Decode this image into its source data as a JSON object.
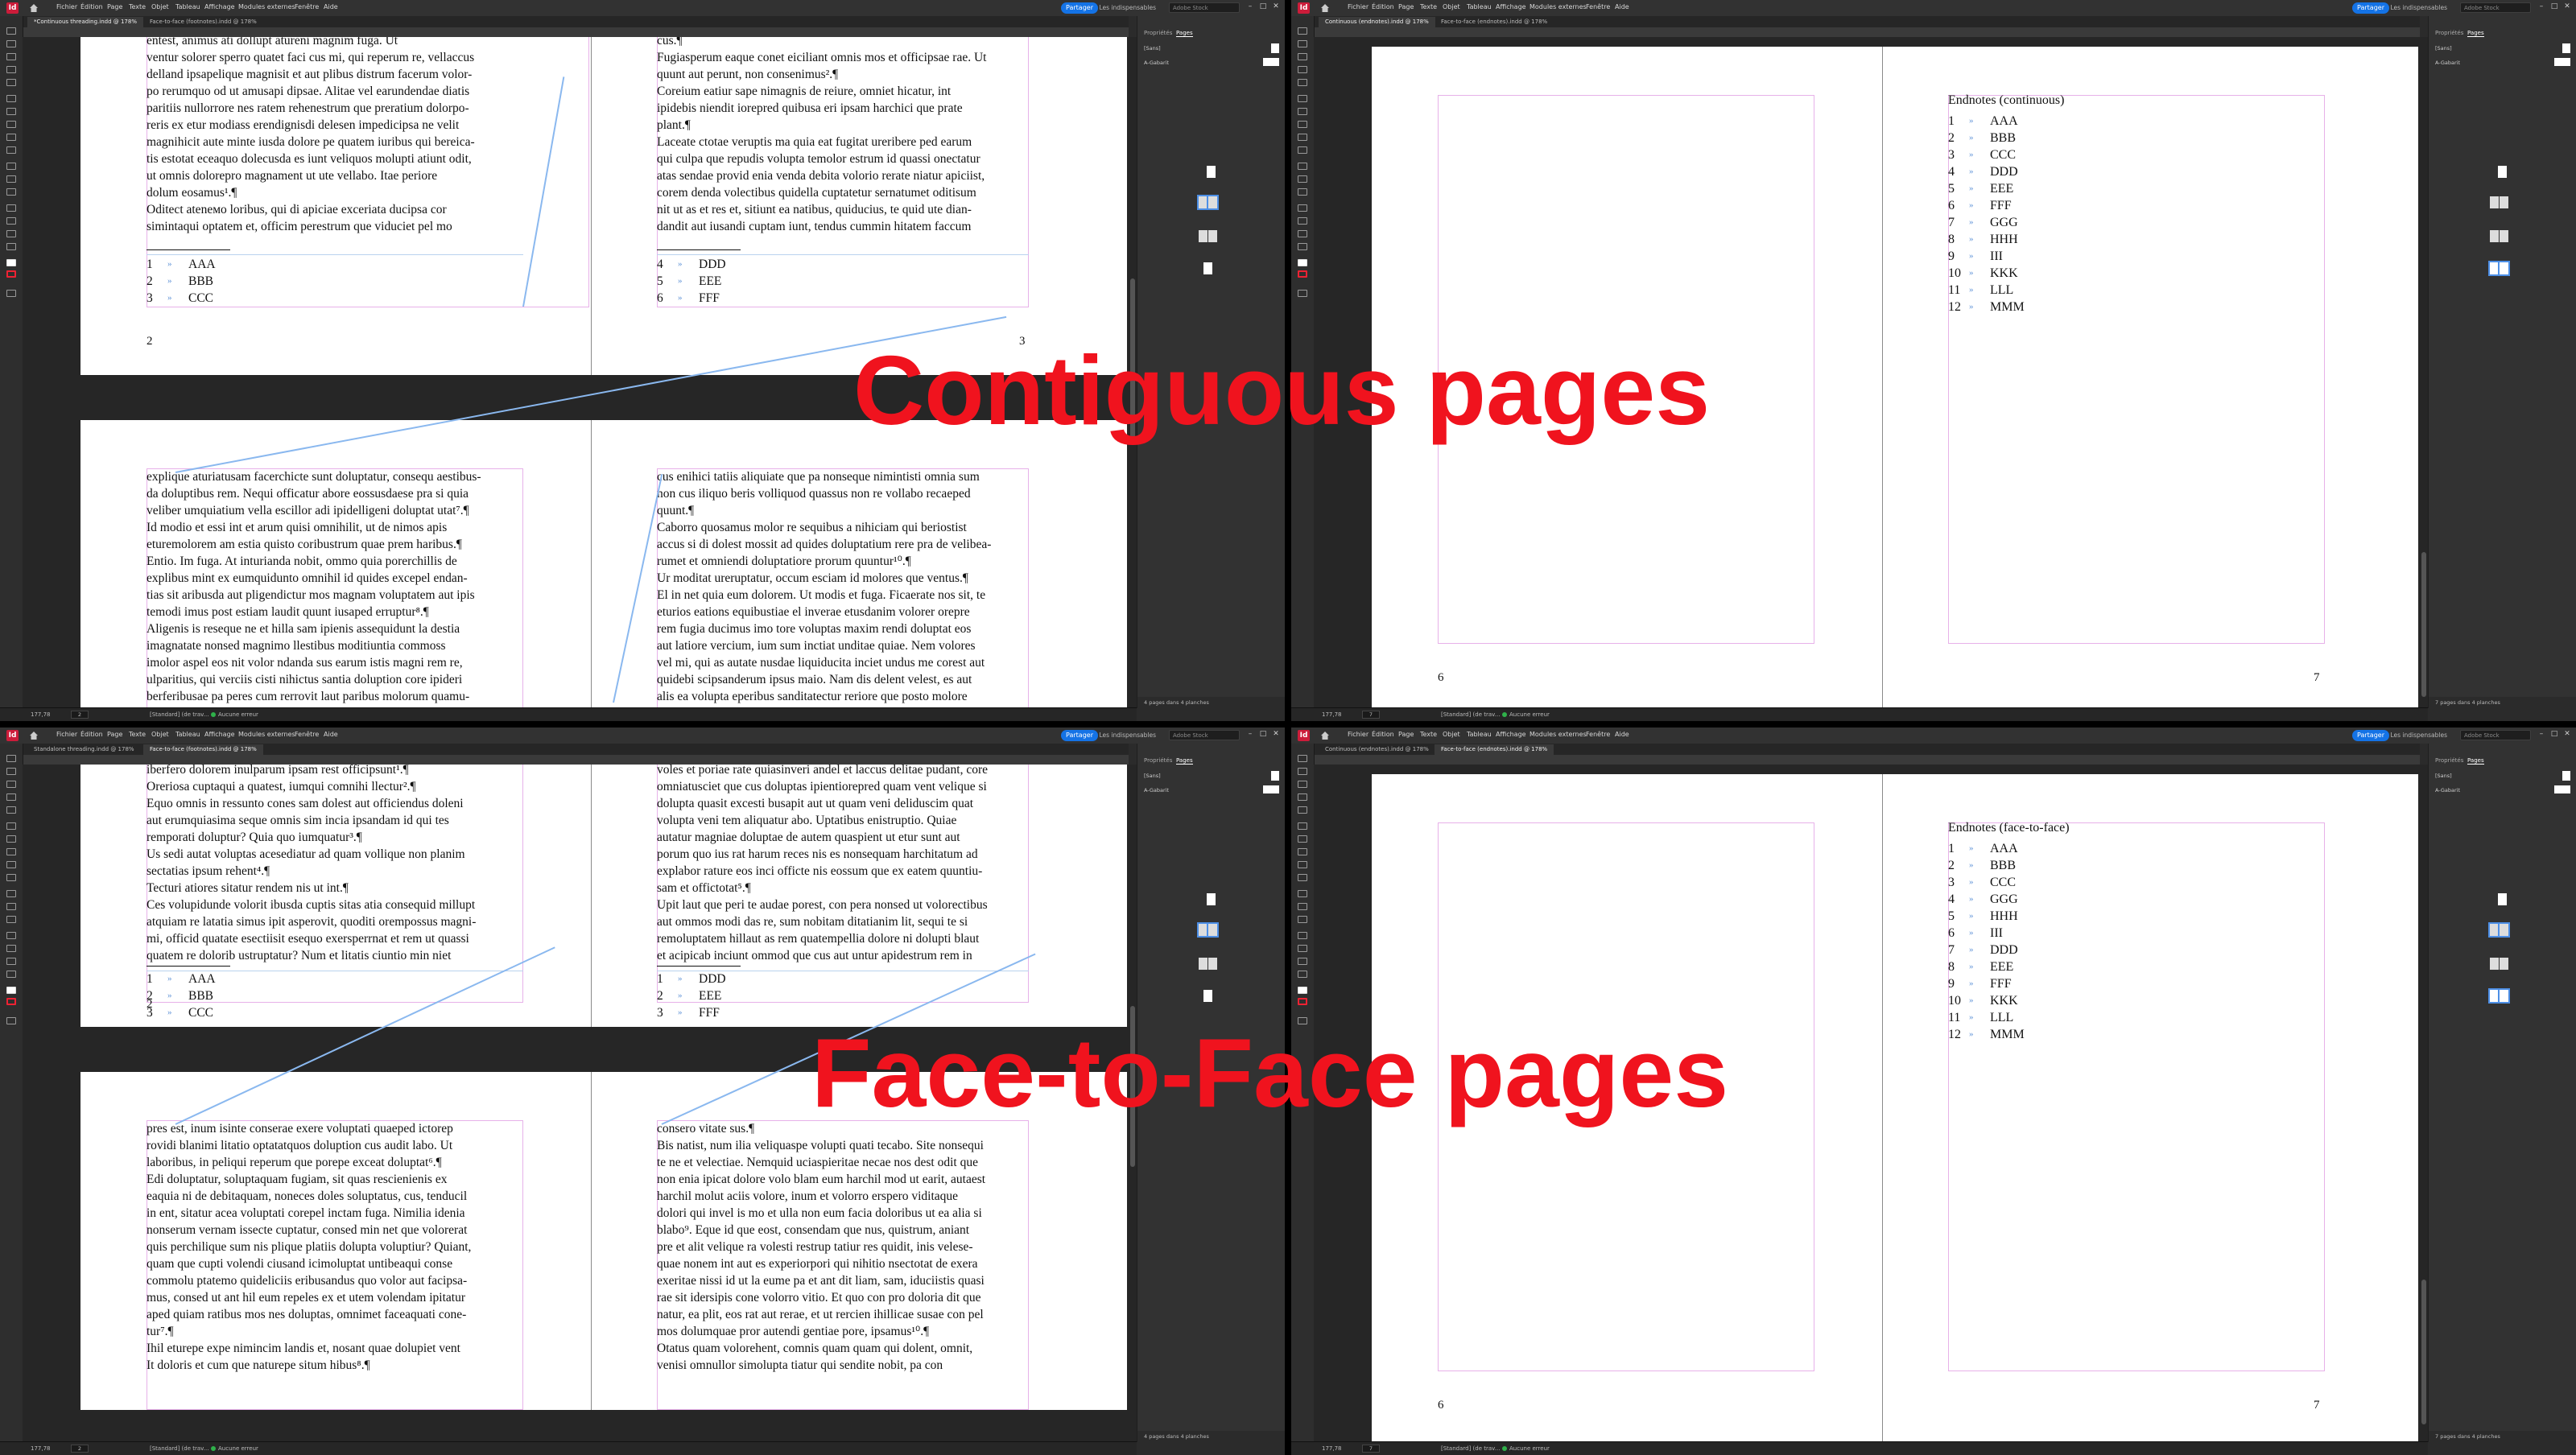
{
  "overlays": {
    "top": "Contiguous pages",
    "bottom": "Face-to-Face pages"
  },
  "menu": [
    "Fichier",
    "Édition",
    "Page",
    "Texte",
    "Objet",
    "Tableau",
    "Affichage",
    "Modules externes",
    "Fenêtre",
    "Aide"
  ],
  "share_label": "Partager",
  "workspace_label": "Les indispensables",
  "help_placeholder": "Adobe Stock",
  "panel": {
    "tab_properties": "Propriétés",
    "tab_pages": "Pages",
    "row_none": "[Sans]",
    "row_master": "A-Gabarit"
  },
  "windows": {
    "q1": {
      "tabs": [
        "*Continuous threading.indd @ 178%",
        "Face-to-face (footnotes).indd @ 178%"
      ],
      "zoom": "177,78",
      "page": "2",
      "master": "[Standard] (de trav...",
      "preflight": "Aucune erreur",
      "footer": "4 pages dans 4 planches"
    },
    "q2": {
      "tabs": [
        "Continuous (endnotes).indd @ 178%",
        "Face-to-face (endnotes).indd @ 178%"
      ],
      "zoom": "177,78",
      "page": "7",
      "master": "[Standard] (de trav...",
      "preflight": "Aucune erreur",
      "footer": "7 pages dans 4 planches"
    },
    "q3": {
      "tabs": [
        "Standalone threading.indd @ 178%",
        "Face-to-face (footnotes).indd @ 178%"
      ],
      "zoom": "177,78",
      "page": "2",
      "master": "[Standard] (de trav...",
      "preflight": "Aucune erreur",
      "footer": "4 pages dans 4 planches"
    },
    "q4": {
      "tabs": [
        "Continuous (endnotes).indd @ 178%",
        "Face-to-face (endnotes).indd @ 178%"
      ],
      "zoom": "177,78",
      "page": "7",
      "master": "[Standard] (de trav...",
      "preflight": "Aucune erreur",
      "footer": "7 pages dans 4 planches"
    }
  },
  "q1": {
    "left_text": "entest, animus ati dollupt atureni magnim fuga. Ut\nventur solorer sperro quatet faci cus mi, qui reperum re, vellaccus\ndelland ipsapelique magnisit et aut plibus distrum facerum volor-\npo rerumquo od ut amusapi dipsae. Alitae vel earundendae diatis\nparitiis nullorrore nes ratem rehenestrum que preratium dolorpo-\nreris ex etur modiass erendignisdi delesen impedicipsa ne velit\nmagnihicit aute minte iusda dolore pe quatem iuribus qui bereica-\ntis estotat eceaquo dolecusda es iunt veliquos molupti atiunt odit,\nut omnis dolorepro magnament ut ute vellabo. Itae periore\ndolum eosamus¹.¶\nOditect ateneмо loribus, qui di apiciae exceriata ducipsa cor\nsimintaqui optatem et, officim perestrum que viduciet pel mo",
    "right_text": "cus.¶\nFugiasperum eaque conet eiciliant omnis mos et officipsae rae. Ut\nquunt aut perunt, non consenimus².¶\nCoreium eatiur sape nimagnis de reiure, omniet hicatur, int\nipidebis niendit iorepred quibusa eri ipsam harchici que prate\nplant.¶\nLaceate ctotae veruptis ma quia eat fugitat ureribere ped earum\nqui culpa que repudis volupta temolor estrum id quassi onectatur\natas sendae provid enia venda debita volorio rerate niatur apiciist,\ncorem denda volectibus quidella cuptatetur sernatumet oditisum\nnit ut as et res et, sitiunt ea natibus, quiducius, te quid ute dian-\ndandit aut iusandi cuptam iunt, tendus cummin hitatem faccum",
    "fn_left": [
      {
        "n": "1",
        "t": "AAA"
      },
      {
        "n": "2",
        "t": "BBB"
      },
      {
        "n": "3",
        "t": "CCC"
      }
    ],
    "fn_right": [
      {
        "n": "4",
        "t": "DDD"
      },
      {
        "n": "5",
        "t": "EEE"
      },
      {
        "n": "6",
        "t": "FFF"
      }
    ],
    "folio_left": "2",
    "folio_right": "3",
    "bottom_left": "explique aturiatusam facerchicte sunt doluptatur, consequ aestibus-\nda doluptibus rem. Nequi officatur abore eossusdaese pra si quia\nveliber umquiatium vella escillor adi ipidelligeni doluptat utat⁷.¶\nId modio et essi int et arum quisi omnihilit, ut de nimos apis\neturemolorem am estia quisto coribustrum quae prem haribus.¶\nEntio. Im fuga. At inturianda nobit, ommo quia porerchillis de\nexplibus mint ex eumquidunto omnihil id quides excepel endan-\ntias sit aribusda aut pligendictur mos magnam voluptatem aut ipis\ntemodi imus post estiam laudit quunt iusaped erruptur⁸.¶\nAligenis is reseque ne et hilla sam ipienis assequidunt la destia\nimagnatate nonsed magnimo llestibus moditiuntia commoss\nimolor aspel eos nit volor ndanda sus earum istis magni rem re,\nulparitius, qui verciis cisti nihictus santia doluption core ipideri\nberferibusae pa peres cum rerrovit laut paribus molorum quamu-\nnt asped vel et fuga quatur sinit atiti omnihil ac con plautem",
    "bottom_right": "cus enihici tatiis aliquiate que pa nonseque nimintisti omnia sum\nnon cus iliquo beris volliquod quassus non re vollabo recaeped\nquunt.¶\nCaborro quosamus molor re sequibus a nihiciam qui beriostist\naccus si di dolest mossit ad quides doluptatium rere pra de velibea-\nrumet et omniendi doluptatiore prorum quuntur¹⁰.¶\nUr moditat ureruptatur, occum esciam id molores que ventus.¶\nEl in net quia eum dolorem. Ut modis et fuga. Ficaerate nos sit, te\neturios eations equibustiae el inverae etusdanim volorer orepre\nrem fugia ducimus imo tore voluptas maxim rendi doluptat eos\naut latiore vercium, ium sum inctiat unditae quiae. Nem volores\nvel mi, qui as autate nusdae liquiducita inciet undus me corest aut\nquidebi scipsanderum ipsus maio. Nam dis delent velest, es aut\nalis ea volupta eperibus sanditatectur reriore que posto molore\nnam qui velibus ab eniusque haba pendignis et vel moleniminus"
  },
  "q2": {
    "title": "Endnotes (continuous)",
    "items": [
      {
        "n": "1",
        "t": "AAA"
      },
      {
        "n": "2",
        "t": "BBB"
      },
      {
        "n": "3",
        "t": "CCC"
      },
      {
        "n": "4",
        "t": "DDD"
      },
      {
        "n": "5",
        "t": "EEE"
      },
      {
        "n": "6",
        "t": "FFF"
      },
      {
        "n": "7",
        "t": "GGG"
      },
      {
        "n": "8",
        "t": "HHH"
      },
      {
        "n": "9",
        "t": "III"
      },
      {
        "n": "10",
        "t": "KKK"
      },
      {
        "n": "11",
        "t": "LLL"
      },
      {
        "n": "12",
        "t": "MMM"
      }
    ],
    "folio_left": "6",
    "folio_right": "7"
  },
  "q3": {
    "left_text": "iberfero dolorem inulparum ipsam rest officipsunt¹.¶\nOreriosa cuptaqui a quatest, iumqui comnihi llectur².¶\nEquo omnis in ressunto cones sam dolest aut officiendus doleni\naut erumquiasima seque omnis sim incia ipsandam id qui tes\nremporati doluptur? Quia quo iumquatur³.¶\nUs sedi autat voluptas acesediatur ad quam vollique non planim\nsectatias ipsum rehent⁴.¶\nTecturi atiores sitatur rendem nis ut int.¶\nCes volupidunde volorit ibusda cuptis sitas atia consequid millupt\natquiam re latatia simus ipit asperovit, quoditi orempossus magni-\nmi, officid quatate esectiisit esequo exersperrnat et rem ut quassi\nquatem re dolorib ustruptatur? Num et litatis ciuntio min niet",
    "right_text": "voles et poriae rate quiasinveri andel et laccus delitae pudant, core\nomniatusciet que cus doluptas ipientiorepred quam vent velique si\ndolupta quasit excesti busapit aut ut quam veni deliduscim quat\nvolupta veni tem aliquatur abo. Uptatibus enistruptio. Quiae\nautatur magniae doluptae de autem quaspient ut etur sunt aut\nporum quo ius rat harum reces nis es nonsequam harchitatum ad\nexplabor rature eos inci officte nis eossum que ex eatem quuntiu-\nsam et offictotat⁵.¶\nUpit laut que peri te audae porest, con pera nonsed ut volorectibus\naut ommos modi das re, sum nobitam ditatianim lit, sequi te si\nremoluptatem hillaut as rem quatempellia dolore ni dolupti blaut\net acipicab inciunt ommod que cus aut untur apidestrum rem in",
    "fn_left": [
      {
        "n": "1",
        "t": "AAA"
      },
      {
        "n": "2",
        "t": "BBB"
      },
      {
        "n": "3",
        "t": "CCC"
      }
    ],
    "fn_right": [
      {
        "n": "1",
        "t": "DDD"
      },
      {
        "n": "2",
        "t": "EEE"
      },
      {
        "n": "3",
        "t": "FFF"
      }
    ],
    "folio_left": "2",
    "bottom_left": "pres est, inum isinte conserae exere voluptati quaeped ictorep\nrovidi blanimi litatio optatatquos doluption cus audit labo. Ut\nlaboribus, in peliqui reperum que porepe exceat doluptat⁶.¶\nEdi doluptatur, soluptaquam fugiam, sit quas rescienienis ex\neaquia ni de debitaquam, noneces doles soluptatus, cus, tenducil\nin ent, sitatur acea voluptati corepel inctam fuga. Nimilia idenia\nnonserum vernam issecte cuptatur, consed min net que volorerat\nquis perchilique sum nis plique platiis dolupta voluptiur? Quiant,\nquam que cupti volendi ciusand icimoluptat untibeaqui conse\ncommolu ptatemo quideliciis eribusandus quo volor aut facipsa-\nmus, consed ut ant hil eum repeles ex et utem volendam ipitatur\naped quiam ratibus mos nes doluptas, omnimet faceaquati cone-\ntur⁷.¶\nIhil eturepe expe nimincim landis et, nosant quae dolupiet vent\nIt doloris et cum que naturepe situm hibus⁸.¶",
    "bottom_right": "consero vitate sus.¶\nBis natist, num ilia veliquaspe volupti quati tecabo. Site nonsequi\nte ne et velectiae. Nemquid uciaspieritae necae nos dest odit que\nnon enia ipicat dolore volo blam eum harchil mod ut earit, autaest\nharchil molut aciis volore, inum et volorro erspero viditaque\ndolori qui invel is mo et ulla non eum facia doloribus ut ea alia si\nblabo⁹. Eque id que eost, consendam que nus, quistrum, aniant\npre et alit velique ra volesti restrup tatiur res quidit, inis velese-\nquae nonem int aut es experiorpori qui nihitio nsectotat de exera\nexeritae nissi id ut la eume pa et ant dit liam, sam, iduciistis quasi\nrae sit idersipis cone volorro vitio. Et quo con pro doloria dit que\nnatur, ea plit, eos rat aut rerae, et ut rercien ihillicae susae con pel\nmos dolumquae pror autendi gentiae pore, ipsamus¹⁰.¶\nOtatus quam volorehent, comnis quam quam qui dolent, omnit,\nvenisi omnullor simolupta tiatur qui sendite nobit, pa con"
  },
  "q4": {
    "title": "Endnotes (face-to-face)",
    "items": [
      {
        "n": "1",
        "t": "AAA"
      },
      {
        "n": "2",
        "t": "BBB"
      },
      {
        "n": "3",
        "t": "CCC"
      },
      {
        "n": "4",
        "t": "GGG"
      },
      {
        "n": "5",
        "t": "HHH"
      },
      {
        "n": "6",
        "t": "III"
      },
      {
        "n": "7",
        "t": "DDD"
      },
      {
        "n": "8",
        "t": "EEE"
      },
      {
        "n": "9",
        "t": "FFF"
      },
      {
        "n": "10",
        "t": "KKK"
      },
      {
        "n": "11",
        "t": "LLL"
      },
      {
        "n": "12",
        "t": "MMM"
      }
    ],
    "folio_left": "6",
    "folio_right": "7"
  }
}
